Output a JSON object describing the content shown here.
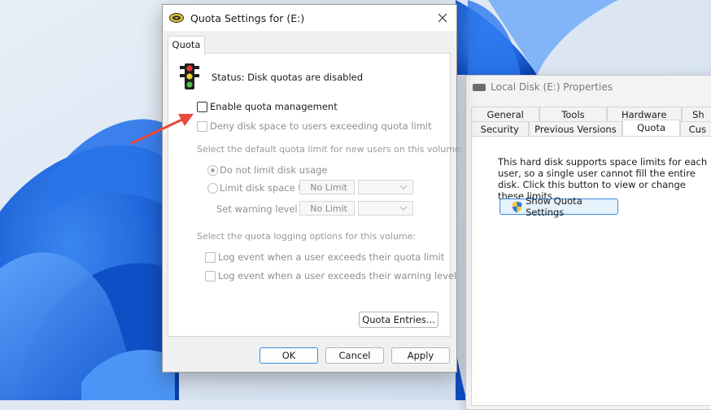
{
  "colors": {
    "accent": "#3c8be0",
    "arrow": "#e8493a",
    "wallpaper_blue": "#1e63d9"
  },
  "icons": {
    "app": "disk-drive-icon",
    "status": "traffic-light-icon",
    "close": "close-icon",
    "shield": "uac-shield-icon",
    "combo_arrow": "chevron-down-icon",
    "annotation": "red-arrow-annotation"
  },
  "background_window": {
    "title": "Local Disk (E:) Properties",
    "tabs_row1": [
      "General",
      "Tools",
      "Hardware",
      "Sh"
    ],
    "tabs_row2": [
      "Security",
      "Previous Versions",
      "Quota",
      "Cus"
    ],
    "active_tab": "Quota",
    "description": "This hard disk supports space limits for each user, so a single user cannot fill the entire disk. Click this button to view or change these limits.",
    "show_quota_button": "Show Quota Settings"
  },
  "dialog": {
    "title": "Quota Settings for  (E:)",
    "tab": "Quota",
    "status": "Status:  Disk quotas are disabled",
    "enable_quota": "Enable quota management",
    "deny_space": "Deny disk space to users exceeding quota limit",
    "default_limit_label": "Select the default quota limit for new users on this volume:",
    "no_limit_radio": "Do not limit disk usage",
    "limit_radio": "Limit disk space to",
    "warning_label": "Set warning level to",
    "limit_value": "No Limit",
    "warning_value": "No Limit",
    "logging_label": "Select the quota logging options for this volume:",
    "log_quota": "Log event when a user exceeds their quota limit",
    "log_warning": "Log event when a user exceeds their warning level",
    "quota_entries": "Quota Entries...",
    "ok": "OK",
    "cancel": "Cancel",
    "apply": "Apply"
  }
}
